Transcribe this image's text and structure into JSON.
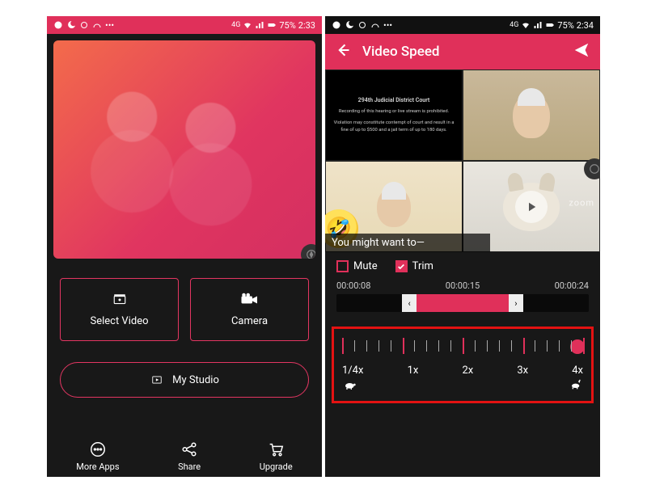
{
  "status": {
    "battery": "75%",
    "net": "4G",
    "time_left": "2:33",
    "time_right": "2:34"
  },
  "home": {
    "select_video": "Select Video",
    "camera": "Camera",
    "my_studio": "My Studio",
    "nav": {
      "more": "More Apps",
      "share": "Share",
      "upgrade": "Upgrade"
    }
  },
  "editor": {
    "title": "Video Speed",
    "caption": "You might want to—",
    "court_line": "294th Judicial District Court",
    "zoom": "zoom",
    "mute": "Mute",
    "trim": "Trim",
    "times": {
      "start": "00:00:08",
      "mid": "00:00:15",
      "end": "00:00:24"
    },
    "speed": {
      "s1": "1/4x",
      "s2": "1x",
      "s3": "2x",
      "s4": "3x",
      "s5": "4x"
    }
  }
}
